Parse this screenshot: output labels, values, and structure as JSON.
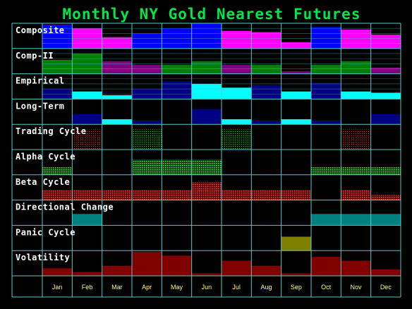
{
  "chart_data": {
    "type": "heatmap",
    "title": "Monthly NY Gold Nearest Futures",
    "categories": [
      "Jan",
      "Feb",
      "Mar",
      "Apr",
      "May",
      "Jun",
      "Jul",
      "Aug",
      "Sep",
      "Oct",
      "Nov",
      "Dec"
    ],
    "colors": {
      "background": "#000000",
      "grid": "#5ac8c8",
      "title": "#00e64d",
      "label": "#ffffff",
      "month_label": "#ffff66"
    },
    "rows": [
      {
        "label": "Composite",
        "style": "bar",
        "color": "#0000ff",
        "alt_color": "#ff00ff",
        "values": [
          0.95,
          0.8,
          0.45,
          0.6,
          0.8,
          1.0,
          0.7,
          0.65,
          0.25,
          0.85,
          0.75,
          0.55
        ],
        "use_alt": [
          false,
          true,
          true,
          false,
          false,
          false,
          true,
          true,
          true,
          false,
          true,
          true
        ]
      },
      {
        "label": "Comp-II",
        "style": "bar",
        "color": "#008000",
        "alt_color": "#800080",
        "values": [
          0.55,
          0.8,
          0.5,
          0.35,
          0.35,
          0.5,
          0.35,
          0.35,
          0.1,
          0.35,
          0.5,
          0.25
        ],
        "use_alt": [
          false,
          false,
          true,
          true,
          false,
          false,
          true,
          false,
          true,
          false,
          false,
          true
        ]
      },
      {
        "label": "Empirical",
        "style": "bar",
        "color": "#000080",
        "alt_color": "#00ffff",
        "values": [
          0.4,
          0.3,
          0.15,
          0.4,
          0.7,
          0.6,
          0.45,
          0.55,
          0.3,
          0.65,
          0.3,
          0.25
        ],
        "use_alt": [
          false,
          true,
          true,
          false,
          false,
          true,
          true,
          false,
          true,
          false,
          true,
          true
        ]
      },
      {
        "label": "Long-Term",
        "style": "bar",
        "color": "#000080",
        "alt_color": "#00ffff",
        "values": [
          0.0,
          0.4,
          0.2,
          0.15,
          0.0,
          0.6,
          0.2,
          0.15,
          0.2,
          0.15,
          0.0,
          0.4
        ],
        "use_alt": [
          false,
          false,
          true,
          false,
          false,
          false,
          true,
          false,
          true,
          false,
          false,
          false
        ]
      },
      {
        "label": "Trading Cycle",
        "style": "pattern",
        "color": "#c83232",
        "alt_color": "#32c832",
        "values": [
          0,
          0.8,
          0,
          0.8,
          0,
          0,
          0.8,
          0,
          0,
          0,
          0.8,
          0
        ],
        "use_alt": [
          false,
          false,
          false,
          true,
          false,
          false,
          true,
          false,
          false,
          false,
          false,
          false
        ]
      },
      {
        "label": "Alpha Cycle",
        "style": "pattern",
        "color": "#32c832",
        "alt_color": "#32c832",
        "values": [
          0.3,
          0,
          0,
          0.6,
          0.6,
          0.6,
          0,
          0,
          0,
          0.3,
          0.3,
          0.3
        ],
        "use_alt": [
          false,
          false,
          false,
          false,
          false,
          false,
          false,
          false,
          false,
          false,
          false,
          false
        ]
      },
      {
        "label": "Beta Cycle",
        "style": "pattern",
        "color": "#e64646",
        "alt_color": "#e64646",
        "values": [
          0.4,
          0.4,
          0.4,
          0.4,
          0.4,
          0.7,
          0.4,
          0.4,
          0.4,
          0,
          0.4,
          0.2
        ],
        "use_alt": [
          false,
          false,
          false,
          false,
          false,
          false,
          false,
          false,
          false,
          false,
          false,
          false
        ]
      },
      {
        "label": "Directional Change",
        "style": "bar",
        "color": "#008080",
        "alt_color": "#008080",
        "values": [
          0,
          0.45,
          0,
          0,
          0,
          0,
          0,
          0,
          0,
          0.45,
          0.45,
          0.45
        ],
        "use_alt": [
          false,
          false,
          false,
          false,
          false,
          false,
          false,
          false,
          false,
          false,
          false,
          false
        ]
      },
      {
        "label": "Panic Cycle",
        "style": "bar",
        "color": "#808000",
        "alt_color": "#808000",
        "values": [
          0,
          0,
          0,
          0,
          0,
          0,
          0,
          0,
          0.55,
          0,
          0,
          0
        ],
        "use_alt": [
          false,
          false,
          false,
          false,
          false,
          false,
          false,
          false,
          false,
          false,
          false,
          false
        ]
      },
      {
        "label": "Volatility",
        "style": "bar",
        "color": "#800000",
        "alt_color": "#800000",
        "values": [
          0.3,
          0.15,
          0.4,
          0.95,
          0.8,
          0.1,
          0.6,
          0.4,
          0.1,
          0.75,
          0.6,
          0.25
        ],
        "use_alt": [
          false,
          false,
          false,
          false,
          false,
          false,
          false,
          false,
          false,
          false,
          false,
          false
        ]
      }
    ]
  }
}
